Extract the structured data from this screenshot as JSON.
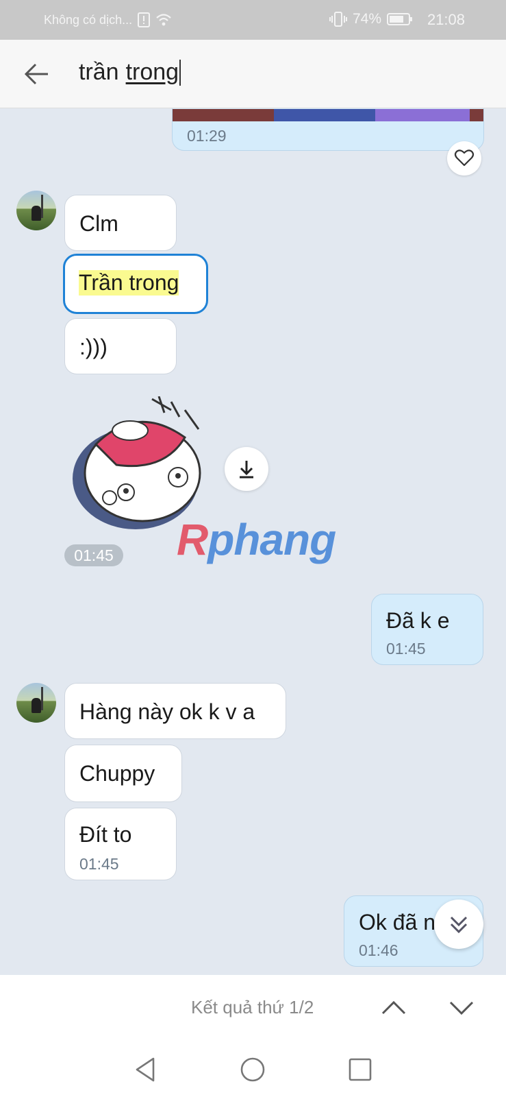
{
  "status_bar": {
    "carrier": "Không có dịch...",
    "battery": "74%",
    "time": "21:08"
  },
  "search": {
    "query_part1": "trần",
    "query_part2": "trong"
  },
  "messages": {
    "top_time": "01:29",
    "m1": "Clm",
    "m2_highlight": "Trần trong",
    "m3": ":)))",
    "sticker_time": "01:45",
    "mine1_text": "Đã k e",
    "mine1_time": "01:45",
    "m4": "Hàng này ok k v a",
    "m5": "Chuppy",
    "m6": "Đít to",
    "m6_time": "01:45",
    "mine2_text": "Ok đã n",
    "mine2_time": "01:46"
  },
  "watermark": {
    "r": "R",
    "rest": "phang"
  },
  "result_bar": {
    "label": "Kết quả thứ 1/2"
  },
  "icons": {
    "back": "arrow-left",
    "heart": "heart-outline",
    "download": "download-arrow",
    "scroll_down": "double-chevron-down",
    "prev_result": "chevron-up",
    "next_result": "chevron-down",
    "sys_back": "triangle",
    "sys_home": "circle",
    "sys_recent": "square"
  }
}
